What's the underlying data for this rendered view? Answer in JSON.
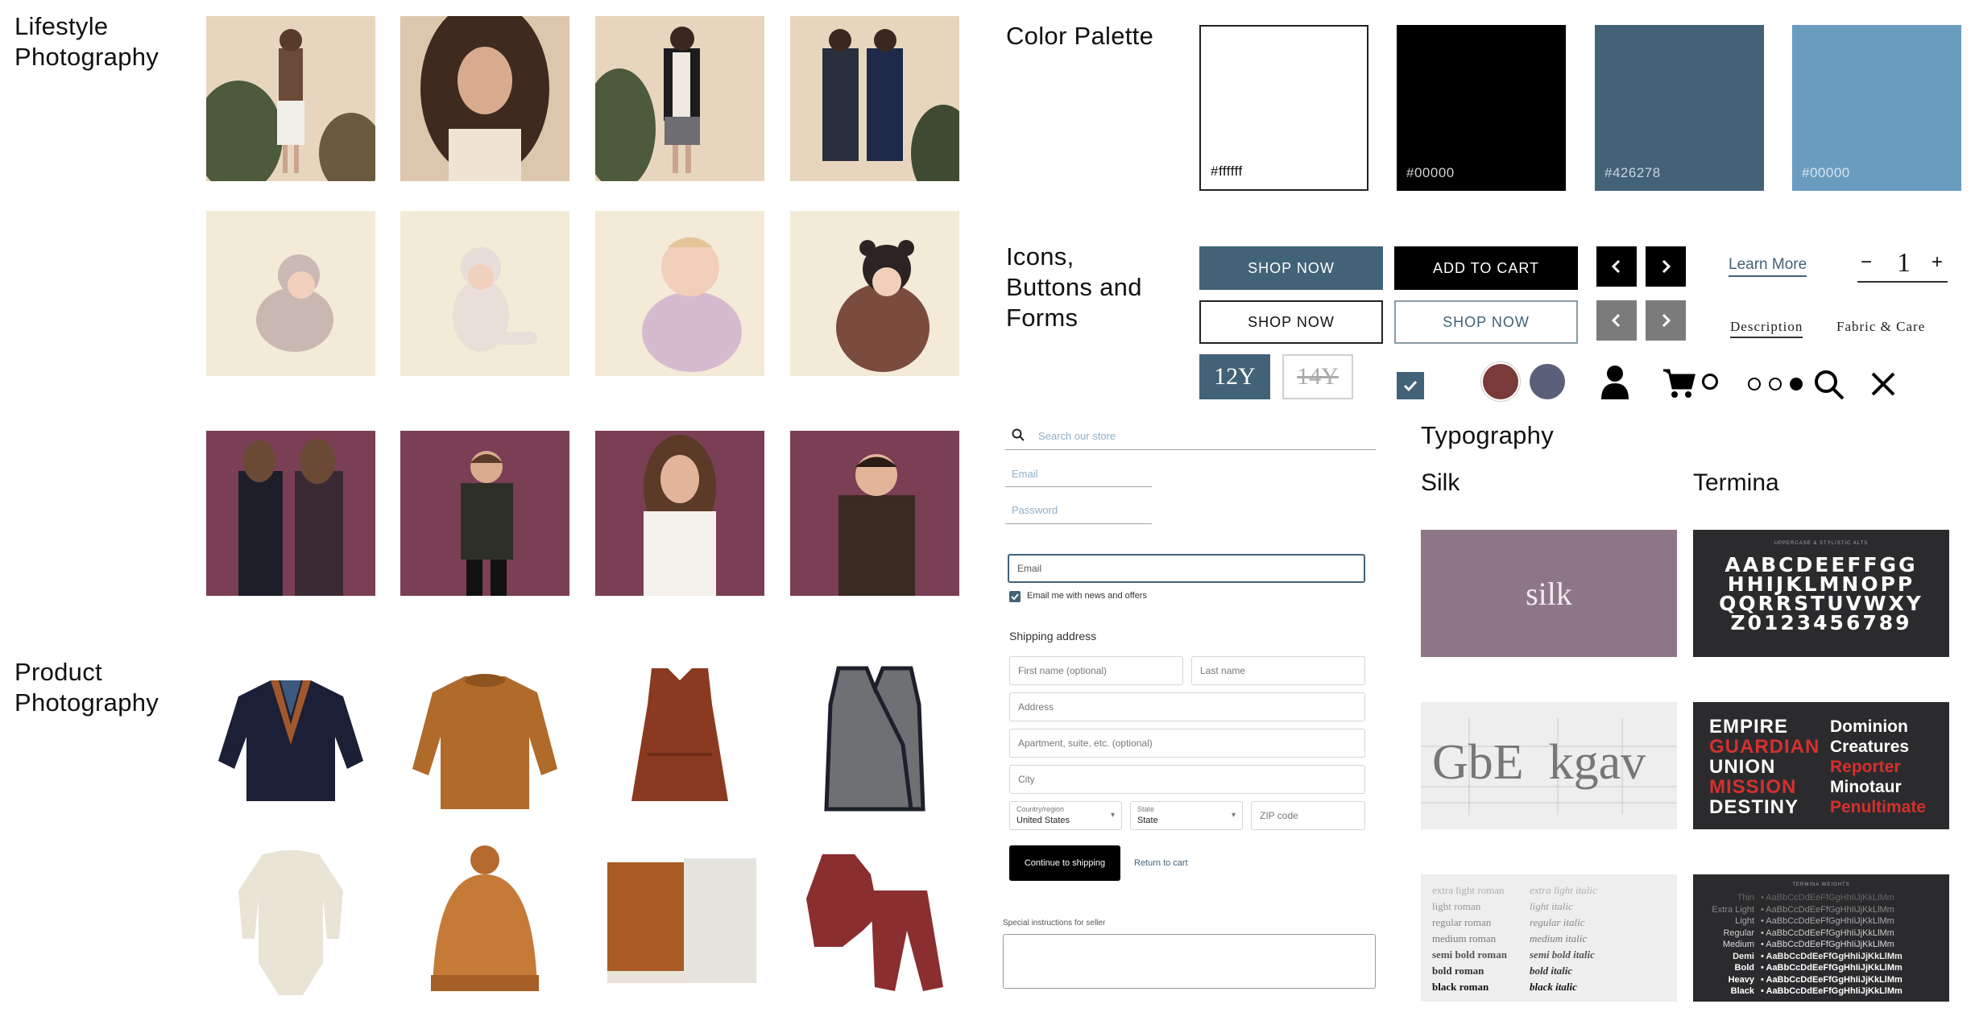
{
  "sections": {
    "lifestyle": [
      "Lifestyle",
      "Photography"
    ],
    "product": [
      "Product",
      "Photography"
    ],
    "palette": "Color Palette",
    "icons": [
      "Icons,",
      "Buttons and",
      "Forms"
    ],
    "typography": "Typography"
  },
  "palette": [
    {
      "hex": "#ffffff",
      "label": "#ffffff",
      "text_color": "#111111"
    },
    {
      "hex": "#000000",
      "label": "#00000",
      "text_color": "#d0d0d0"
    },
    {
      "hex": "#426278",
      "label": "#426278",
      "text_color": "#c9d6df"
    },
    {
      "hex": "#6a9cc0",
      "label": "#00000",
      "text_color": "#d8e6f0"
    }
  ],
  "buttons": {
    "shop_now_blue": "SHOP NOW",
    "add_to_cart": "ADD TO CART",
    "shop_now_outline": "SHOP NOW",
    "shop_now_outline_blue": "SHOP NOW",
    "learn_more": "Learn More",
    "qty_minus": "−",
    "qty_value": "1",
    "qty_plus": "+",
    "tab_description": "Description",
    "tab_fabric": "Fabric & Care",
    "size_selected": "12Y",
    "size_unavailable": "14Y"
  },
  "colors": {
    "accent_blue": "#426278",
    "swatch_maroon": "#7b3a3a",
    "swatch_slate": "#5a5f7a"
  },
  "icons": [
    "arrow-left-icon",
    "arrow-right-icon",
    "checkbox-checked-icon",
    "user-icon",
    "cart-icon",
    "search-icon",
    "close-icon"
  ],
  "form": {
    "search_placeholder": "Search our store",
    "email_placeholder": "Email",
    "password_placeholder": "Password",
    "email_focused": "Email",
    "newsletter": "Email me with news and offers",
    "shipping_heading": "Shipping address",
    "first_name": "First name (optional)",
    "last_name": "Last name",
    "address": "Address",
    "apartment": "Apartment, suite, etc. (optional)",
    "city": "City",
    "country_label": "Country/region",
    "country_value": "United States",
    "state_label": "State",
    "state_value": "State",
    "zip": "ZIP code",
    "continue": "Continue to shipping",
    "return": "Return to cart",
    "special": "Special instructions for seller"
  },
  "typography": {
    "silk_title": "Silk",
    "termina_title": "Termina",
    "silk_word": "silk",
    "silk_specimen": "GbE  kgav",
    "termina_alts_label": "UPPERCASE & STYLISTIC ALTS",
    "termina_rows": [
      "AABCDEEFFGG",
      "HHIJKLMNOPP",
      "QQRRSTUVWXY",
      "Z0123456789"
    ],
    "termina_words_left": [
      "EMPIRE",
      "GUARDIAN",
      "UNION",
      "MISSION",
      "DESTINY"
    ],
    "termina_words_right": [
      "Dominion",
      "Creatures",
      "Reporter",
      "Minotaur",
      "Penultimate"
    ],
    "silk_weights_roman": [
      "extra light roman",
      "light roman",
      "regular roman",
      "medium roman",
      "semi bold roman",
      "bold roman",
      "black roman"
    ],
    "silk_weights_italic": [
      "extra light italic",
      "light italic",
      "regular italic",
      "medium italic",
      "semi bold italic",
      "bold italic",
      "black italic"
    ],
    "termina_weights_label": "TERMINA WEIGHTS",
    "termina_weights": [
      "Thin",
      "Extra Light",
      "Light",
      "Regular",
      "Medium",
      "Demi",
      "Bold",
      "Heavy",
      "Black"
    ],
    "termina_sample": "AaBbCcDdEeFfGgHhIiJjKkLlMm"
  }
}
